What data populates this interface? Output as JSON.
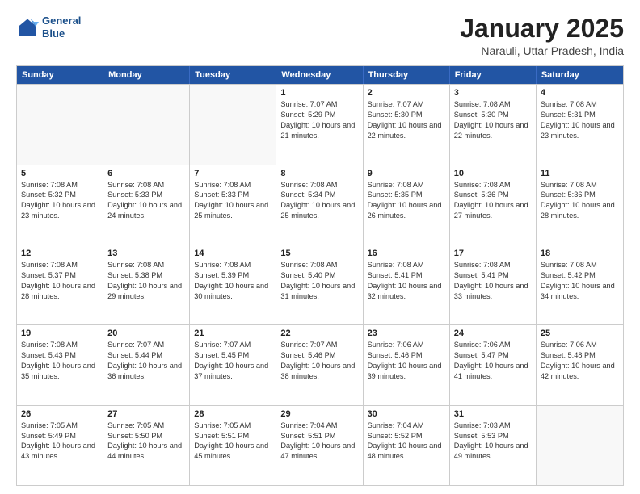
{
  "header": {
    "logo_line1": "General",
    "logo_line2": "Blue",
    "title": "January 2025",
    "subtitle": "Narauli, Uttar Pradesh, India"
  },
  "days_of_week": [
    "Sunday",
    "Monday",
    "Tuesday",
    "Wednesday",
    "Thursday",
    "Friday",
    "Saturday"
  ],
  "rows": [
    [
      {
        "day": "",
        "empty": true
      },
      {
        "day": "",
        "empty": true
      },
      {
        "day": "",
        "empty": true
      },
      {
        "day": "1",
        "sunrise": "7:07 AM",
        "sunset": "5:29 PM",
        "daylight": "10 hours and 21 minutes."
      },
      {
        "day": "2",
        "sunrise": "7:07 AM",
        "sunset": "5:30 PM",
        "daylight": "10 hours and 22 minutes."
      },
      {
        "day": "3",
        "sunrise": "7:08 AM",
        "sunset": "5:30 PM",
        "daylight": "10 hours and 22 minutes."
      },
      {
        "day": "4",
        "sunrise": "7:08 AM",
        "sunset": "5:31 PM",
        "daylight": "10 hours and 23 minutes."
      }
    ],
    [
      {
        "day": "5",
        "sunrise": "7:08 AM",
        "sunset": "5:32 PM",
        "daylight": "10 hours and 23 minutes."
      },
      {
        "day": "6",
        "sunrise": "7:08 AM",
        "sunset": "5:33 PM",
        "daylight": "10 hours and 24 minutes."
      },
      {
        "day": "7",
        "sunrise": "7:08 AM",
        "sunset": "5:33 PM",
        "daylight": "10 hours and 25 minutes."
      },
      {
        "day": "8",
        "sunrise": "7:08 AM",
        "sunset": "5:34 PM",
        "daylight": "10 hours and 25 minutes."
      },
      {
        "day": "9",
        "sunrise": "7:08 AM",
        "sunset": "5:35 PM",
        "daylight": "10 hours and 26 minutes."
      },
      {
        "day": "10",
        "sunrise": "7:08 AM",
        "sunset": "5:36 PM",
        "daylight": "10 hours and 27 minutes."
      },
      {
        "day": "11",
        "sunrise": "7:08 AM",
        "sunset": "5:36 PM",
        "daylight": "10 hours and 28 minutes."
      }
    ],
    [
      {
        "day": "12",
        "sunrise": "7:08 AM",
        "sunset": "5:37 PM",
        "daylight": "10 hours and 28 minutes."
      },
      {
        "day": "13",
        "sunrise": "7:08 AM",
        "sunset": "5:38 PM",
        "daylight": "10 hours and 29 minutes."
      },
      {
        "day": "14",
        "sunrise": "7:08 AM",
        "sunset": "5:39 PM",
        "daylight": "10 hours and 30 minutes."
      },
      {
        "day": "15",
        "sunrise": "7:08 AM",
        "sunset": "5:40 PM",
        "daylight": "10 hours and 31 minutes."
      },
      {
        "day": "16",
        "sunrise": "7:08 AM",
        "sunset": "5:41 PM",
        "daylight": "10 hours and 32 minutes."
      },
      {
        "day": "17",
        "sunrise": "7:08 AM",
        "sunset": "5:41 PM",
        "daylight": "10 hours and 33 minutes."
      },
      {
        "day": "18",
        "sunrise": "7:08 AM",
        "sunset": "5:42 PM",
        "daylight": "10 hours and 34 minutes."
      }
    ],
    [
      {
        "day": "19",
        "sunrise": "7:08 AM",
        "sunset": "5:43 PM",
        "daylight": "10 hours and 35 minutes."
      },
      {
        "day": "20",
        "sunrise": "7:07 AM",
        "sunset": "5:44 PM",
        "daylight": "10 hours and 36 minutes."
      },
      {
        "day": "21",
        "sunrise": "7:07 AM",
        "sunset": "5:45 PM",
        "daylight": "10 hours and 37 minutes."
      },
      {
        "day": "22",
        "sunrise": "7:07 AM",
        "sunset": "5:46 PM",
        "daylight": "10 hours and 38 minutes."
      },
      {
        "day": "23",
        "sunrise": "7:06 AM",
        "sunset": "5:46 PM",
        "daylight": "10 hours and 39 minutes."
      },
      {
        "day": "24",
        "sunrise": "7:06 AM",
        "sunset": "5:47 PM",
        "daylight": "10 hours and 41 minutes."
      },
      {
        "day": "25",
        "sunrise": "7:06 AM",
        "sunset": "5:48 PM",
        "daylight": "10 hours and 42 minutes."
      }
    ],
    [
      {
        "day": "26",
        "sunrise": "7:05 AM",
        "sunset": "5:49 PM",
        "daylight": "10 hours and 43 minutes."
      },
      {
        "day": "27",
        "sunrise": "7:05 AM",
        "sunset": "5:50 PM",
        "daylight": "10 hours and 44 minutes."
      },
      {
        "day": "28",
        "sunrise": "7:05 AM",
        "sunset": "5:51 PM",
        "daylight": "10 hours and 45 minutes."
      },
      {
        "day": "29",
        "sunrise": "7:04 AM",
        "sunset": "5:51 PM",
        "daylight": "10 hours and 47 minutes."
      },
      {
        "day": "30",
        "sunrise": "7:04 AM",
        "sunset": "5:52 PM",
        "daylight": "10 hours and 48 minutes."
      },
      {
        "day": "31",
        "sunrise": "7:03 AM",
        "sunset": "5:53 PM",
        "daylight": "10 hours and 49 minutes."
      },
      {
        "day": "",
        "empty": true
      }
    ]
  ]
}
